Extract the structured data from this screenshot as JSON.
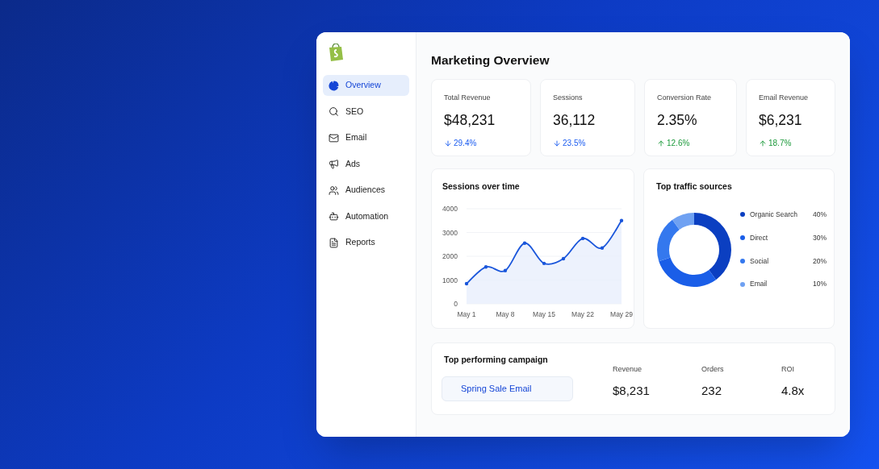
{
  "sidebar": {
    "items": [
      {
        "label": "Overview",
        "selected": true
      },
      {
        "label": "SEO",
        "selected": false
      },
      {
        "label": "Email",
        "selected": false
      },
      {
        "label": "Ads",
        "selected": false
      },
      {
        "label": "Audiences",
        "selected": false
      },
      {
        "label": "Automation",
        "selected": false
      },
      {
        "label": "Reports",
        "selected": false
      }
    ]
  },
  "title": "Marketing Overview",
  "stats": [
    {
      "label": "Total Revenue",
      "value": "$48,231",
      "change": "29.4%",
      "kind": "decrease"
    },
    {
      "label": "Sessions",
      "value": "36,112",
      "change": "23.5%",
      "kind": "decrease"
    },
    {
      "label": "Conversion Rate",
      "value": "2.35%",
      "change": "12.6%",
      "kind": "increase"
    },
    {
      "label": "Email Revenue",
      "value": "$6,231",
      "change": "18.7%",
      "kind": "increase"
    }
  ],
  "sessions_card": {
    "title": "Sessions over time",
    "chart_data": {
      "type": "area",
      "categories": [
        "May 1",
        null,
        "May 8",
        null,
        "May 15",
        null,
        "May 22",
        null,
        "May 29"
      ],
      "series": [
        {
          "color": "#1a56db",
          "values": [
            850,
            1550,
            1400,
            2550,
            1700,
            1900,
            2750,
            2350,
            3500
          ]
        }
      ],
      "ylim": [
        0,
        4000
      ],
      "grid": true,
      "yticks": [
        0,
        1000,
        2000,
        3000,
        4000
      ]
    }
  },
  "traffic_card": {
    "title": "Top traffic sources",
    "chart_data": {
      "type": "donut",
      "categories": [
        "Organic Search",
        "Direct",
        "Social",
        "Email"
      ],
      "series": [
        {
          "values": [
            40,
            30,
            20,
            10
          ]
        }
      ]
    },
    "legend": [
      {
        "percent": "40%",
        "color": "#0b3fc1"
      },
      {
        "percent": "30%",
        "color": "#1a5ee8"
      },
      {
        "percent": "20%",
        "color": "#3478ee"
      },
      {
        "percent": "10%",
        "color": "#6fa1f2"
      }
    ]
  },
  "campaign": {
    "title": "Top performing campaign",
    "name": "Spring Sale Email",
    "metrics": [
      {
        "label": "Revenue",
        "value": "$8,231"
      },
      {
        "label": "Orders",
        "value": "232"
      },
      {
        "label": "ROI",
        "value": "4.8x"
      }
    ]
  }
}
